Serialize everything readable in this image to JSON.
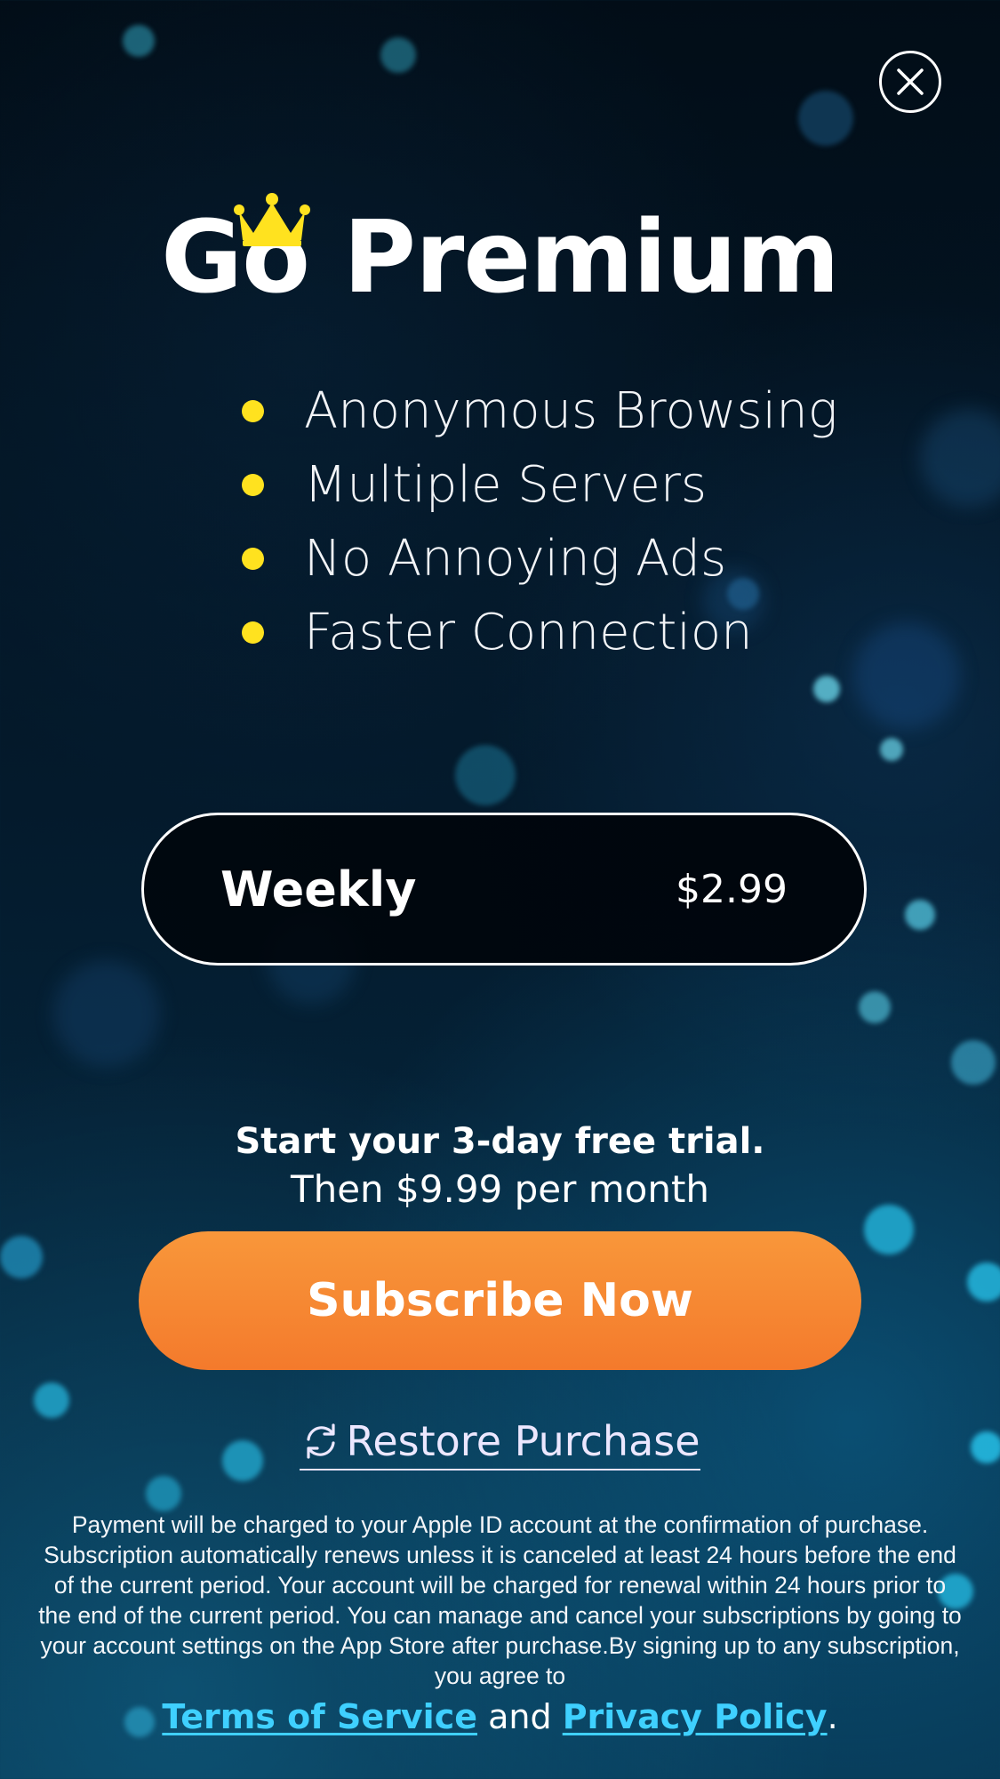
{
  "title": "Go Premium",
  "features": [
    "Anonymous Browsing",
    "Multiple Servers",
    "No Annoying Ads",
    "Faster Connection"
  ],
  "plan": {
    "name": "Weekly",
    "price": "$2.99"
  },
  "trial": {
    "heading": "Start your 3-day free trial.",
    "subtext": "Then $9.99 per month"
  },
  "subscribe_label": "Subscribe Now",
  "restore_label": "Restore Purchase",
  "legal_text": "Payment will be charged to your Apple ID account at the confirmation of purchase. Subscription automatically renews unless it is canceled at least 24 hours before the end of the current period. Your account will be charged for renewal within 24 hours prior to the end of the current period. You can manage and cancel your subscriptions by going to your account settings on the App Store after purchase.By signing up to any subscription, you agree to",
  "links": {
    "terms": "Terms of Service",
    "and": "and",
    "privacy": "Privacy Policy",
    "period": "."
  },
  "icons": {
    "close": "close-icon",
    "crown": "crown-icon",
    "restore": "refresh-icon"
  },
  "colors": {
    "accent_orange": "#f58a33",
    "bullet_yellow": "#ffe21f",
    "crown_yellow": "#ffe21f",
    "link_cyan": "#3fd0ff",
    "background_dark": "#031525"
  }
}
